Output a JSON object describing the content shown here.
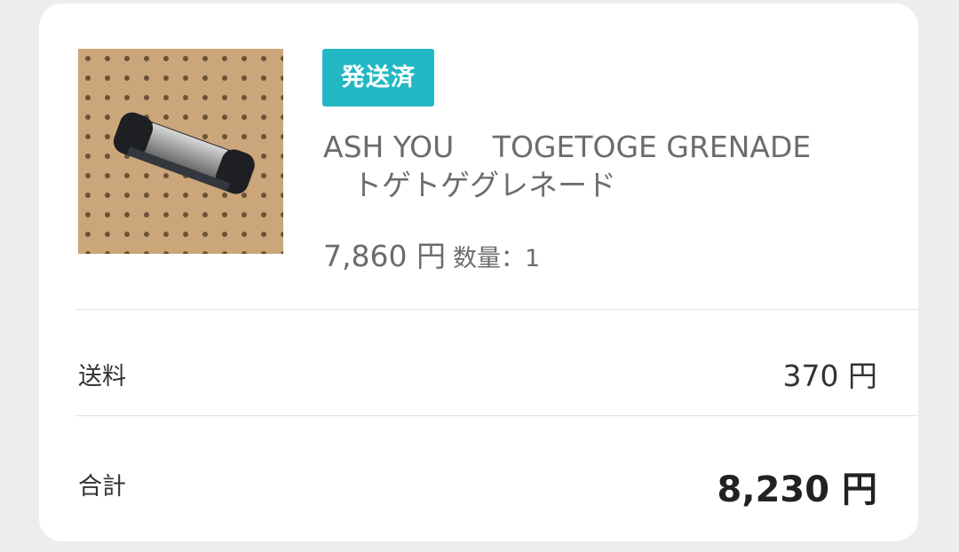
{
  "order": {
    "status_badge": "発送済",
    "product_title": "ASH YOU　 TOGETOGE GRENADE\n　トゲトゲグレネード",
    "unit_price": "7,860 円",
    "quantity_text": "数量：1"
  },
  "summary": {
    "shipping_label": "送料",
    "shipping_value": "370 円",
    "total_label": "合計",
    "total_value": "8,230 円"
  },
  "colors": {
    "badge": "#22b8c3",
    "background": "#eceeee",
    "card": "#ffffff"
  }
}
